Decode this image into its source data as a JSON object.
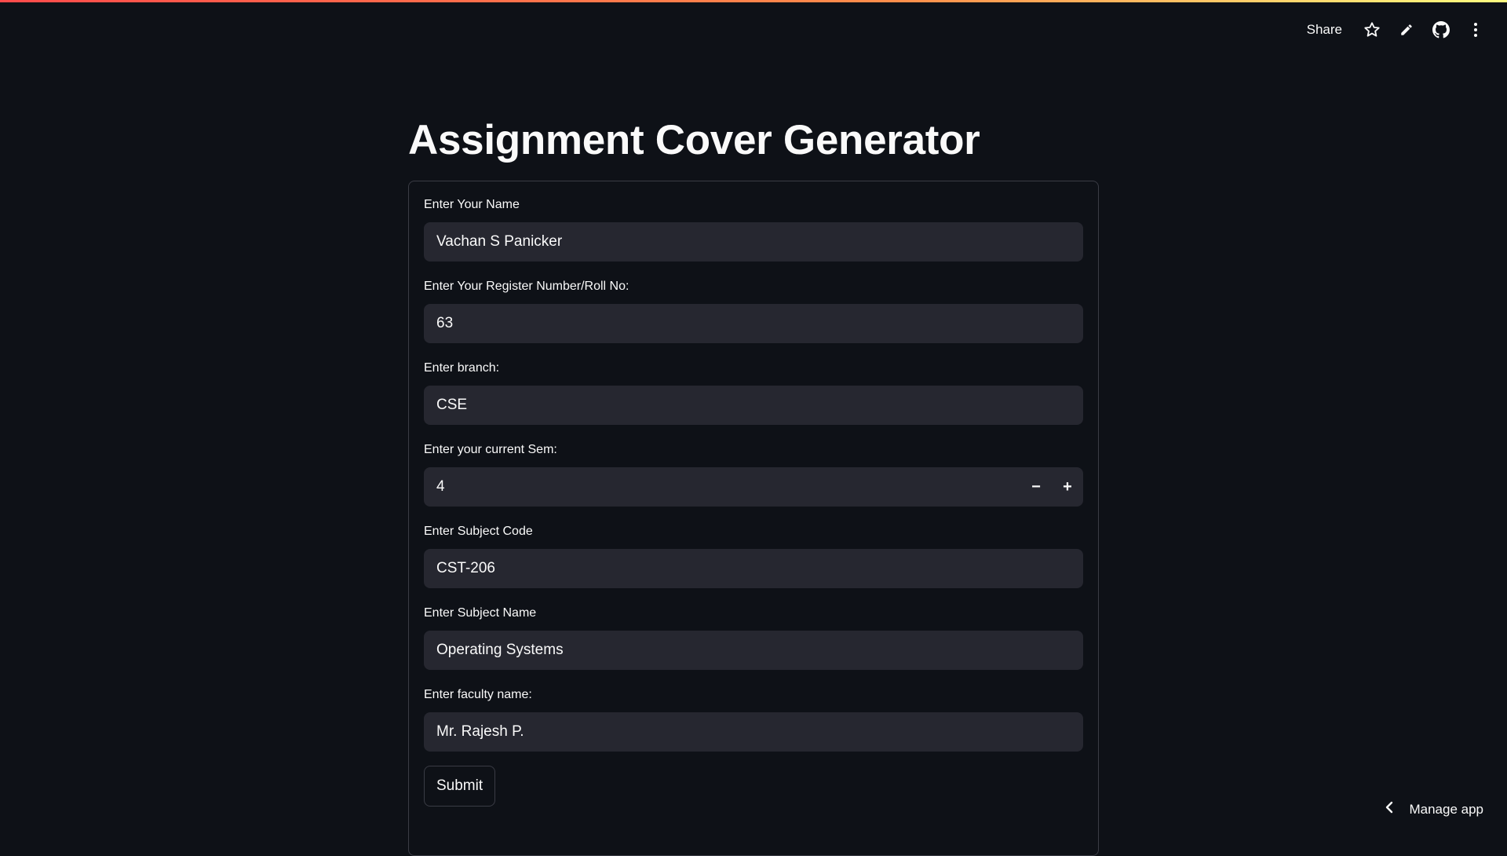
{
  "header": {
    "share_label": "Share",
    "icons": [
      "star-icon",
      "pencil-icon",
      "github-icon",
      "kebab-menu-icon"
    ]
  },
  "page": {
    "title": "Assignment Cover Generator"
  },
  "form": {
    "fields": [
      {
        "label": "Enter Your Name",
        "value": "Vachan S Panicker"
      },
      {
        "label": "Enter Your Register Number/Roll No:",
        "value": "63"
      },
      {
        "label": "Enter branch:",
        "value": "CSE"
      },
      {
        "label": "Enter your current Sem:",
        "value": "4",
        "decrement": "−",
        "increment": "+"
      },
      {
        "label": "Enter Subject Code",
        "value": "CST-206"
      },
      {
        "label": "Enter Subject Name",
        "value": "Operating Systems"
      },
      {
        "label": "Enter faculty name:",
        "value": "Mr. Rajesh P."
      }
    ],
    "submit_label": "Submit"
  },
  "footer": {
    "manage_app_label": "Manage app"
  },
  "colors": {
    "background": "#0e1117",
    "input_bg": "#262730",
    "border": "#3a3c45",
    "text": "#fafafa",
    "accent_gradient_start": "#ff4b4b",
    "accent_gradient_end": "#fffd80"
  }
}
